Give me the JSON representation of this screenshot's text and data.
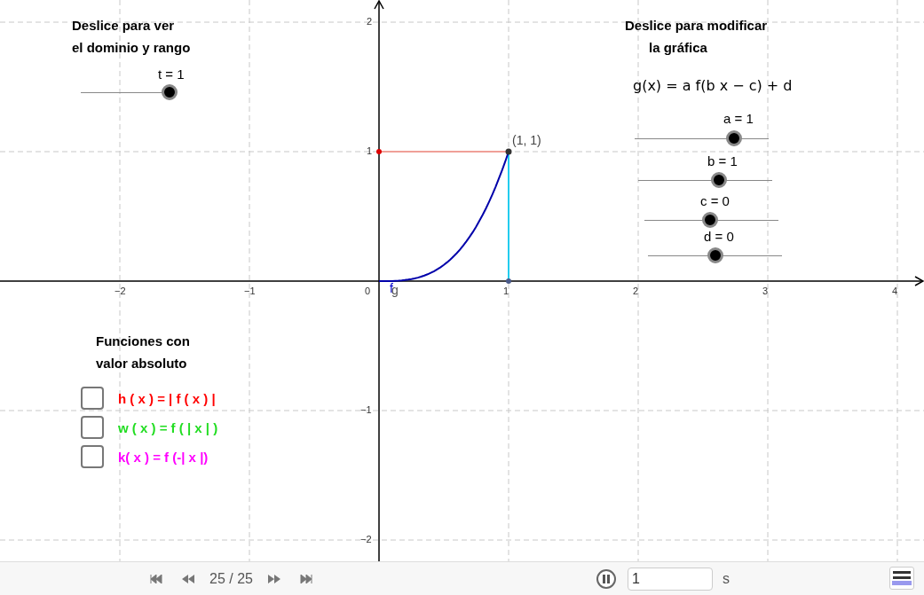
{
  "graph": {
    "x_tick_labels": [
      "−2",
      "−1",
      "0",
      "1",
      "2",
      "3",
      "4"
    ],
    "y_tick_labels": [
      "2",
      "1",
      "−1",
      "−2"
    ],
    "point_label": "(1, 1)",
    "curve_labels": [
      "f",
      "g"
    ]
  },
  "domain_panel": {
    "title_lines": [
      "Deslice para ver",
      "el dominio y rango"
    ],
    "slider": {
      "label": "t = 1",
      "level": 1
    }
  },
  "modify_panel": {
    "title_lines": [
      "Deslice para modificar",
      "la gráfica"
    ],
    "formula": "g(x) = a f(b x − c) + d",
    "sliders": [
      {
        "label": "a = 1",
        "level": 0.74
      },
      {
        "label": "b = 1",
        "level": 0.6
      },
      {
        "label": "c = 0",
        "level": 0.49
      },
      {
        "label": "d = 0",
        "level": 0.5
      }
    ]
  },
  "abs_panel": {
    "title_lines": [
      "Funciones con",
      "valor absoluto"
    ],
    "checkboxes": [
      {
        "label": "h ( x ) = | f ( x ) |",
        "checked": false,
        "color": "#ff0000"
      },
      {
        "label": "w ( x ) = f ( | x | )",
        "checked": false,
        "color": "#22dd22"
      },
      {
        "label": "k( x ) = f (-| x |)",
        "checked": false,
        "color": "#ff00ff"
      }
    ]
  },
  "toolbar": {
    "frame": "25 / 25",
    "speed": "1",
    "unit": "s",
    "playing": true
  }
}
